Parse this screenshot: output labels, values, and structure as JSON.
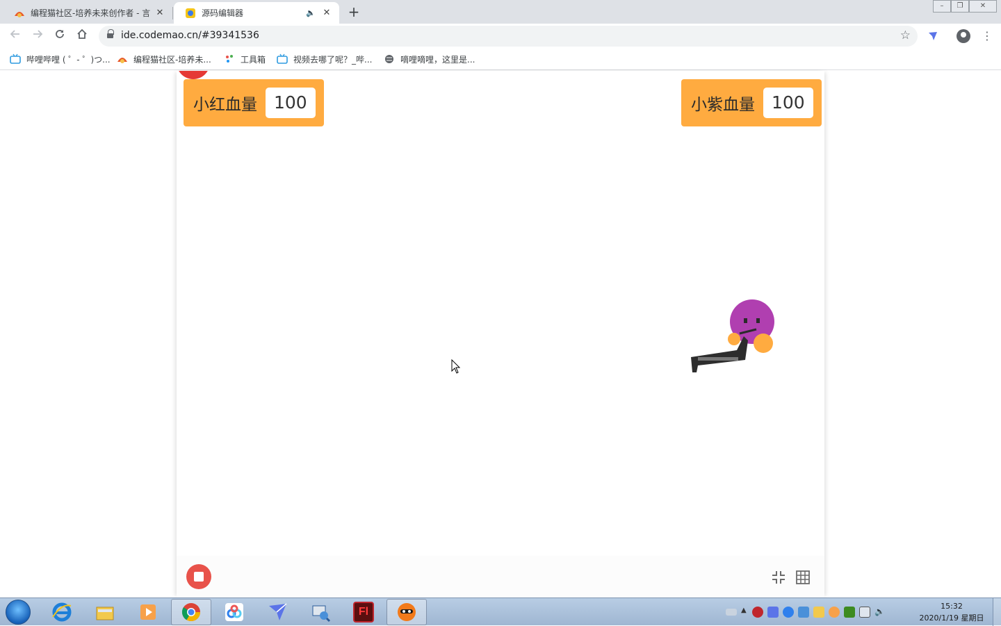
{
  "browser": {
    "tabs": [
      {
        "title": "编程猫社区-培养未来创作者 - 言",
        "active": false
      },
      {
        "title": "源码编辑器",
        "active": true
      }
    ],
    "new_tab_label": "+",
    "close_symbol": "✕",
    "mute_symbol": "🔈",
    "url": "ide.codemao.cn/#39341536",
    "bookmarks": [
      {
        "label": "哔哩哔哩 ( ゜- ゜)つ...",
        "icon": "bilibili-icon"
      },
      {
        "label": "编程猫社区-培养未...",
        "icon": "codemao-icon"
      },
      {
        "label": "工具箱",
        "icon": "toolbox-icon"
      },
      {
        "label": "视频去哪了呢？_哔...",
        "icon": "bilibili-tv-icon"
      },
      {
        "label": "嘀哩嘀哩，这里是...",
        "icon": "globe-icon"
      }
    ]
  },
  "stage": {
    "monitors": [
      {
        "label": "小红血量",
        "value": "100"
      },
      {
        "label": "小紫血量",
        "value": "100"
      }
    ],
    "colors": {
      "monitor_bg": "#ffab40",
      "stop_button": "#e8524a",
      "purple_sprite": "#b03fb0",
      "red_sprite": "#e53935"
    }
  },
  "taskbar": {
    "apps": [
      "ie-icon",
      "explorer-folder-icon",
      "media-player-icon",
      "chrome-icon",
      "baidu-netdisk-icon",
      "feishu-icon",
      "network-tool-icon",
      "flash-icon",
      "codemao-app-icon"
    ],
    "flash_label": "Fl",
    "time": "15:32",
    "date": "2020/1/19 星期日"
  }
}
